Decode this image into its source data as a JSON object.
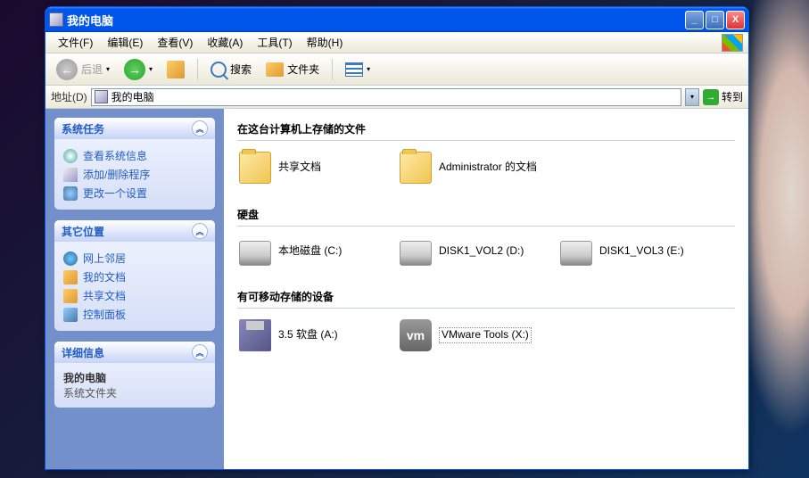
{
  "window": {
    "title": "我的电脑"
  },
  "titleButtons": {
    "min": "_",
    "max": "□",
    "close": "X"
  },
  "menu": {
    "file": "文件(F)",
    "edit": "编辑(E)",
    "view": "查看(V)",
    "favorites": "收藏(A)",
    "tools": "工具(T)",
    "help": "帮助(H)"
  },
  "toolbar": {
    "back": "后退",
    "search": "搜索",
    "folders": "文件夹"
  },
  "address": {
    "label": "地址(D)",
    "value": "我的电脑",
    "go": "转到"
  },
  "sidebar": {
    "tasks": {
      "title": "系统任务",
      "items": [
        "查看系统信息",
        "添加/删除程序",
        "更改一个设置"
      ]
    },
    "other": {
      "title": "其它位置",
      "items": [
        "网上邻居",
        "我的文档",
        "共享文档",
        "控制面板"
      ]
    },
    "details": {
      "title": "详细信息",
      "name": "我的电脑",
      "type": "系统文件夹"
    }
  },
  "sections": {
    "files": {
      "title": "在这台计算机上存储的文件",
      "items": [
        {
          "label": "共享文档"
        },
        {
          "label": "Administrator 的文档"
        }
      ]
    },
    "drives": {
      "title": "硬盘",
      "items": [
        {
          "label": "本地磁盘 (C:)"
        },
        {
          "label": "DISK1_VOL2 (D:)"
        },
        {
          "label": "DISK1_VOL3 (E:)"
        }
      ]
    },
    "removable": {
      "title": "有可移动存储的设备",
      "items": [
        {
          "label": "3.5 软盘 (A:)"
        },
        {
          "label": "VMware Tools (X:)"
        }
      ]
    }
  }
}
